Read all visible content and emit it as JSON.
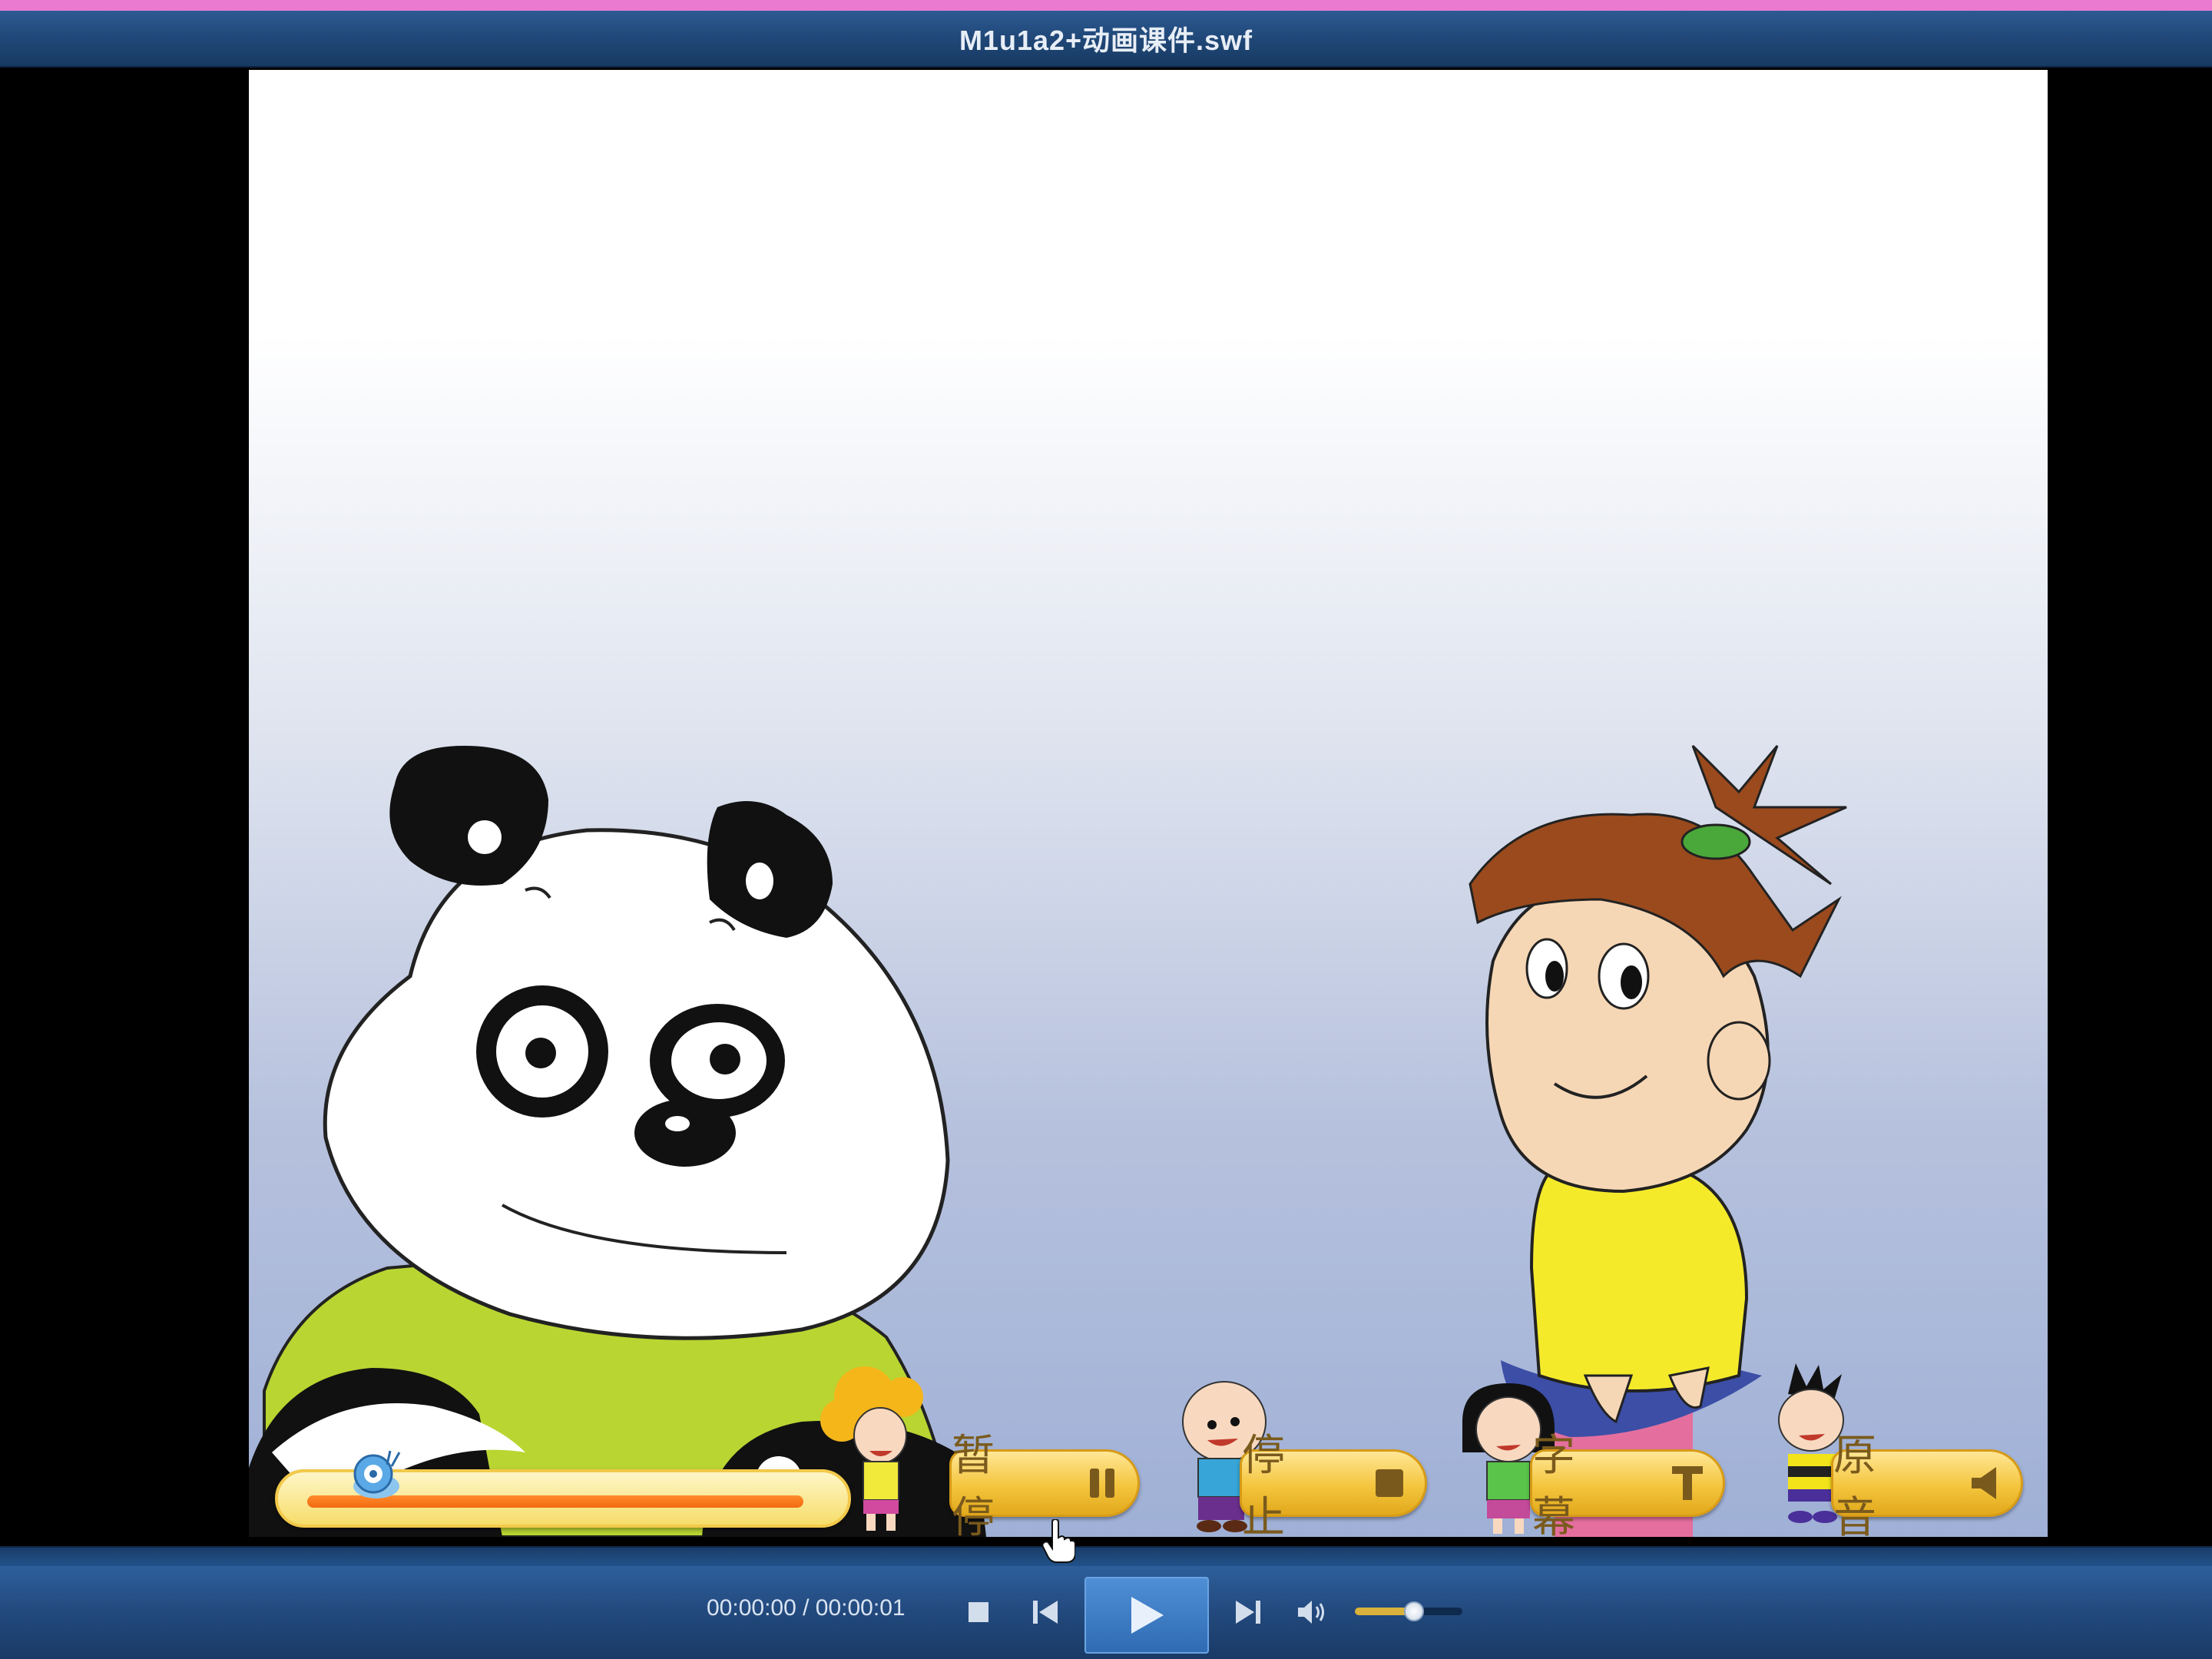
{
  "window": {
    "title": "M1u1a2+动画课件.swf"
  },
  "course": {
    "progress_fraction": 0.97,
    "buttons": {
      "pause": "暂 停",
      "stop": "停 止",
      "subtitle": "字 幕",
      "original_audio": "原 音"
    }
  },
  "player": {
    "time_display": "00:00:00 / 00:00:01",
    "volume_fraction": 0.55,
    "icons": {
      "stop": "stop-icon",
      "previous": "previous-icon",
      "play": "play-icon",
      "next": "next-icon",
      "volume": "speaker-icon"
    }
  },
  "colors": {
    "accent_blue": "#2f6bb2",
    "title_bar": "#1f4675",
    "course_button_gold": "#f4c53d",
    "progress_orange": "#f36a10"
  }
}
